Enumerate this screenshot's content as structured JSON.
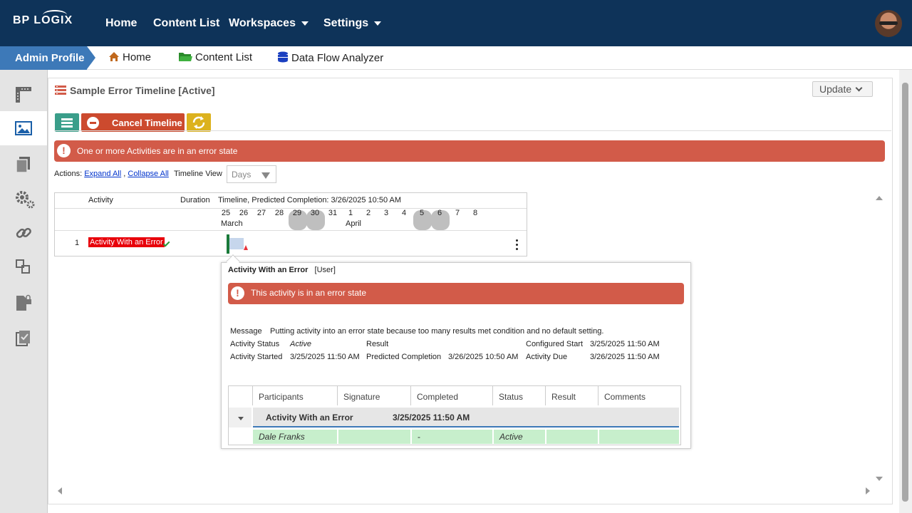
{
  "app": {
    "logo": "BP LOGIX"
  },
  "topnav": {
    "home": "Home",
    "content_list": "Content List",
    "workspaces": "Workspaces",
    "settings": "Settings"
  },
  "breadcrumb": {
    "admin": "Admin Profile",
    "home": "Home",
    "content_list": "Content List",
    "data_flow": "Data Flow Analyzer"
  },
  "page": {
    "title": "Sample Error Timeline [Active]",
    "update": "Update"
  },
  "toolbar": {
    "cancel": "Cancel Timeline"
  },
  "error_banner": "One or more Activities are in an error state",
  "actions": {
    "label": "Actions:",
    "expand_all": "Expand All",
    "sep": ",",
    "collapse_all": "Collapse All",
    "timeline_view_label": "Timeline View",
    "timeline_view_value": "Days"
  },
  "timeline": {
    "col_activity": "Activity",
    "col_duration": "Duration",
    "col_timeline": "Timeline, Predicted Completion: 3/26/2025 10:50 AM",
    "days": [
      "25",
      "26",
      "27",
      "28",
      "29",
      "30",
      "31",
      "1",
      "2",
      "3",
      "4",
      "5",
      "6",
      "7",
      "8"
    ],
    "months": [
      "March",
      "April"
    ],
    "row": {
      "num": "1",
      "activity": "Activity With an Error"
    }
  },
  "popup": {
    "title": "Activity With an Error",
    "role": "[User]",
    "error": "This activity is in an error state",
    "message_label": "Message",
    "message": "Putting activity into an error state because too many results met condition and no default setting.",
    "status_label": "Activity Status",
    "status": "Active",
    "result_label": "Result",
    "result": "",
    "config_start_label": "Configured Start",
    "config_start": "3/25/2025 11:50 AM",
    "started_label": "Activity Started",
    "started": "3/25/2025 11:50 AM",
    "pred_label": "Predicted Completion",
    "pred": "3/26/2025 10:50 AM",
    "due_label": "Activity Due",
    "due": "3/26/2025 11:50 AM",
    "table": {
      "headers": [
        "Participants",
        "Signature",
        "Completed",
        "Status",
        "Result",
        "Comments"
      ],
      "group_name": "Activity With an Error",
      "group_date": "3/25/2025 11:50 AM",
      "row": {
        "participant": "Dale Franks",
        "signature": "",
        "completed": "-",
        "status": "Active",
        "result": "",
        "comments": ""
      }
    }
  }
}
